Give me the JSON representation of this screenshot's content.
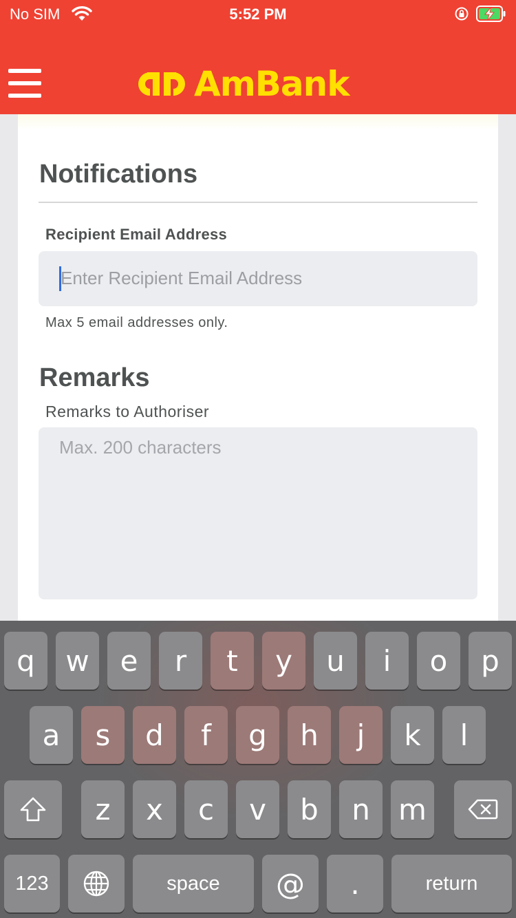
{
  "status_bar": {
    "carrier": "No SIM",
    "time": "5:52 PM"
  },
  "header": {
    "brand": "AmBank",
    "brand_color": "#ffe001",
    "bar_color": "#ef4233"
  },
  "notifications": {
    "title": "Notifications",
    "email_label": "Recipient Email Address",
    "email_placeholder": "Enter Recipient Email Address",
    "email_value": "",
    "email_hint": "Max 5 email addresses only."
  },
  "remarks": {
    "title": "Remarks",
    "label": "Remarks to Authoriser",
    "placeholder": "Max. 200 characters",
    "value": ""
  },
  "keyboard": {
    "row1": [
      "q",
      "w",
      "e",
      "r",
      "t",
      "y",
      "u",
      "i",
      "o",
      "p"
    ],
    "row2": [
      "a",
      "s",
      "d",
      "f",
      "g",
      "h",
      "j",
      "k",
      "l"
    ],
    "row3": [
      "z",
      "x",
      "c",
      "v",
      "b",
      "n",
      "m"
    ],
    "numbers_label": "123",
    "space_label": "space",
    "at_label": "@",
    "period_label": ".",
    "return_label": "return"
  }
}
